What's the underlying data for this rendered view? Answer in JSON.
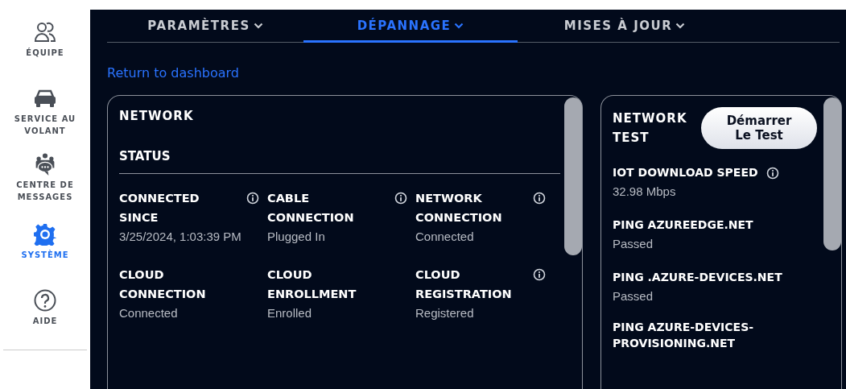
{
  "sidebar": {
    "items": [
      {
        "label": "ÉQUIPE",
        "selected": false
      },
      {
        "label": "SERVICE AU VOLANT",
        "selected": false
      },
      {
        "label": "CENTRE DE MESSAGES",
        "selected": false
      },
      {
        "label": "SYSTÈME",
        "selected": true
      },
      {
        "label": "AIDE",
        "selected": false
      }
    ]
  },
  "tabs": [
    {
      "label": "PARAMÈTRES",
      "selected": false
    },
    {
      "label": "DÉPANNAGE",
      "selected": true
    },
    {
      "label": "MISES À JOUR",
      "selected": false
    }
  ],
  "back_link": "Return to dashboard",
  "network_card": {
    "title": "NETWORK",
    "section": "STATUS",
    "fields": [
      {
        "label": "CONNECTED SINCE",
        "value": "3/25/2024, 1:03:39 PM",
        "info": true
      },
      {
        "label": "CABLE CONNECTION",
        "value": "Plugged In",
        "info": true
      },
      {
        "label": "NETWORK CONNECTION",
        "value": "Connected",
        "info": true
      },
      {
        "label": "CLOUD CONNECTION",
        "value": "Connected",
        "info": false
      },
      {
        "label": "CLOUD ENROLLMENT",
        "value": "Enrolled",
        "info": false
      },
      {
        "label": "CLOUD REGISTRATION",
        "value": "Registered",
        "info": true
      }
    ]
  },
  "test_card": {
    "title": "NETWORK TEST",
    "button": "Démarrer Le Test",
    "results": [
      {
        "label": "IOT DOWNLOAD SPEED",
        "value": "32.98 Mbps",
        "info": true
      },
      {
        "label": "PING AZUREEDGE.NET",
        "value": "Passed",
        "info": false
      },
      {
        "label": "PING .AZURE-DEVICES.NET",
        "value": "Passed",
        "info": false
      },
      {
        "label": "PING AZURE-DEVICES-PROVISIONING.NET",
        "info": false
      }
    ]
  }
}
